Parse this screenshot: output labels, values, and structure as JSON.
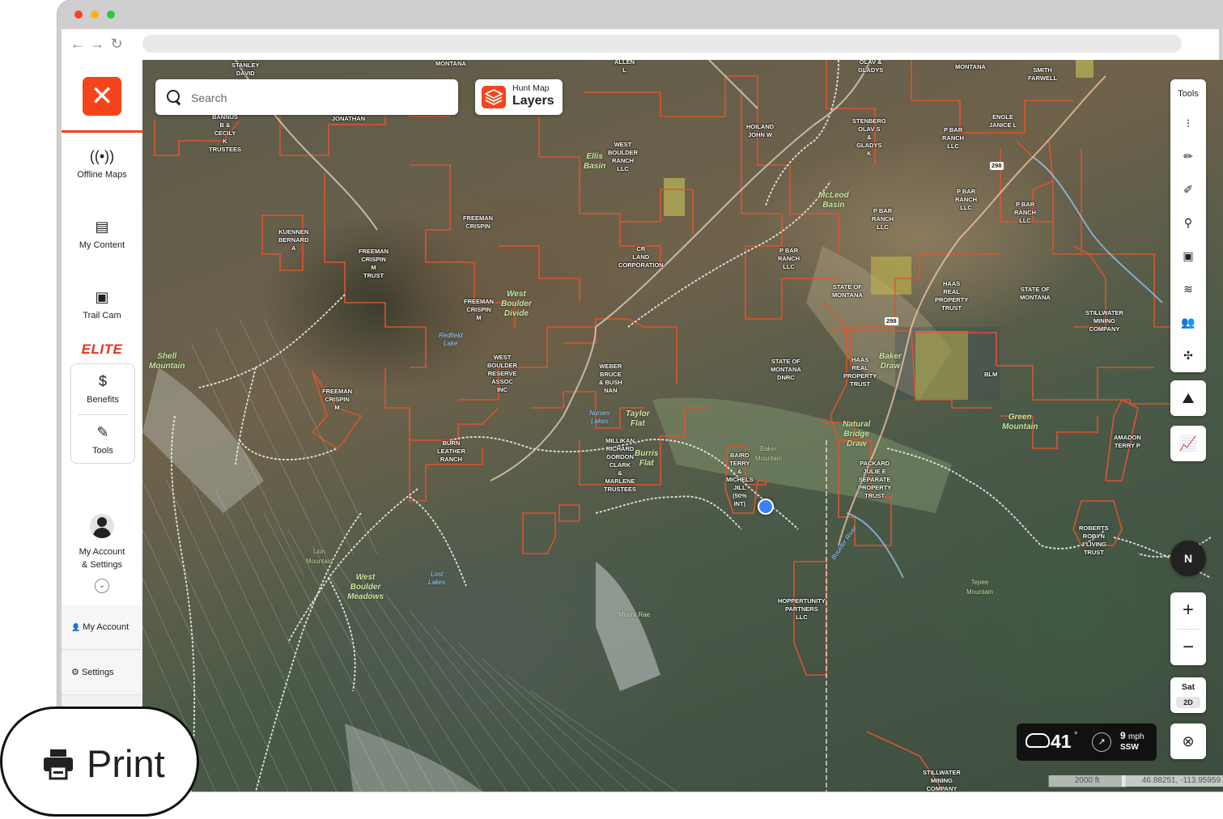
{
  "browser": {
    "back": "←",
    "forward": "→",
    "reload": "↻"
  },
  "sidebar": {
    "brand_glyph": "✕",
    "items": [
      {
        "label": "Offline Maps",
        "icon": "offline-maps-icon",
        "glyph": "((•))"
      },
      {
        "label": "My Content",
        "icon": "folder-icon",
        "glyph": "▤"
      },
      {
        "label": "Trail Cam",
        "icon": "trail-cam-icon",
        "glyph": "▣"
      }
    ],
    "elite_label": "ELITE",
    "elite_items": [
      {
        "label": "Benefits",
        "icon": "dollar-circle-icon",
        "glyph": "$"
      },
      {
        "label": "Tools",
        "icon": "tools-icon",
        "glyph": "✎"
      }
    ],
    "account_label_line1": "My Account",
    "account_label_line2": "& Settings",
    "menu": [
      {
        "label": "My Account",
        "glyph": "👤"
      },
      {
        "label": "Settings",
        "glyph": "⚙"
      }
    ]
  },
  "search": {
    "placeholder": "Search"
  },
  "layers": {
    "small": "Hunt Map",
    "big": "Layers"
  },
  "tools": {
    "title": "Tools",
    "items": [
      {
        "name": "route-icon",
        "glyph": "⁝"
      },
      {
        "name": "draw-line-icon",
        "glyph": "✏"
      },
      {
        "name": "draw-shape-icon",
        "glyph": "✐"
      },
      {
        "name": "waypoint-icon",
        "glyph": "⚲"
      },
      {
        "name": "trail-cam-icon",
        "glyph": "▣"
      },
      {
        "name": "wind-icon",
        "glyph": "≋"
      },
      {
        "name": "people-icon",
        "glyph": "👥"
      },
      {
        "name": "satellite-icon",
        "glyph": "✣"
      }
    ]
  },
  "map_buttons": {
    "terrain_glyph": "⛰",
    "chart_glyph": "📈",
    "compass": "N",
    "zoom_in": "+",
    "zoom_out": "−",
    "basemap_top": "Sat",
    "basemap_bottom": "2D",
    "locate_glyph": "⊗"
  },
  "weather": {
    "temp": "41",
    "deg": "°",
    "wind_speed": "9",
    "wind_unit": "mph",
    "wind_dir": "SSW",
    "wind_glyph": "↗"
  },
  "scale": "2000 ft",
  "coordinates": "46.88251, -113.95959",
  "print_label": "Print",
  "map_labels": {
    "parcels": [
      "STANLEY\nDAVID",
      "MONTANA",
      "ALLEN\nL",
      "OLAV &\nGLADYS",
      "MONTANA",
      "SMITH\nFARWELL",
      "BANNUS\nB &\nCECILY\nK\nTRUSTEES",
      "JONATHAN",
      "WEST\nBOULDER\nRANCH\nLLC",
      "HOILAND\nJOHN W",
      "STENBERG\nOLAV S\n&\nGLADYS\nK",
      "P BAR\nRANCH\nLLC",
      "ENGLE\nJANICE L",
      "KUENNEN\nBERNARD\nA",
      "FREEMAN\nCRISPIN",
      "FREEMAN\nCRISPIN\nM\nTRUST",
      "CR\nLAND\nCORPORATION",
      "P BAR\nRANCH\nLLC",
      "P BAR\nRANCH\nLLC",
      "P BAR\nRANCH\nLLC",
      "P BAR\nRANCH\nLLC",
      "FREEMAN\nCRISPIN\nM",
      "STATE OF\nMONTANA",
      "HAAS\nREAL\nPROPERTY\nTRUST",
      "STATE OF\nMONTANA",
      "STILLWATER\nMINING\nCOMPANY",
      "WEST\nBOULDER\nRESERVE\nASSOC\nINC",
      "WEBER\nBRUCE\n& BUSH\nNAN",
      "STATE OF\nMONTANA\nDNRC",
      "HAAS\nREAL\nPROPERTY\nTRUST",
      "BLM",
      "FREEMAN\nCRISPIN\nM",
      "BURN\nLEATHER\nRANCH",
      "MILLIKAN\nRICHARD\nGORDON\nCLARK\n&\nMARLENE\nTRUSTEES",
      "BAIRD\nTERRY\n&\nMICHELS\nJILL\n(50%\nINT)",
      "PACKARD\nJULIE E\nSEPARATE\nPROPERTY\nTRUST",
      "AMADON\nTERRY P",
      "ROBERTS\nROBYN\nJ LIVING\nTRUST",
      "HOPPERTUNITY\nPARTNERS\nLLC",
      "STILLWATER\nMINING\nCOMPANY"
    ],
    "features": [
      "Ellis\nBasin",
      "McLeod\nBasin",
      "West\nBoulder\nDivide",
      "Shell\nMountain",
      "Taylor\nFlat",
      "Burris\nFlat",
      "Baker\nDraw",
      "Natural\nBridge\nDraw",
      "Green\nMountain",
      "Lion\nMountain",
      "West\nBoulder\nMeadows",
      "Mount Rae",
      "Tepee\nMountain",
      "Baker\nMountain"
    ],
    "water": [
      "Redfield\nLake",
      "Nurses\nLakes",
      "Lost\nLakes",
      "Boulder River"
    ],
    "roads": [
      "298",
      "298"
    ]
  }
}
